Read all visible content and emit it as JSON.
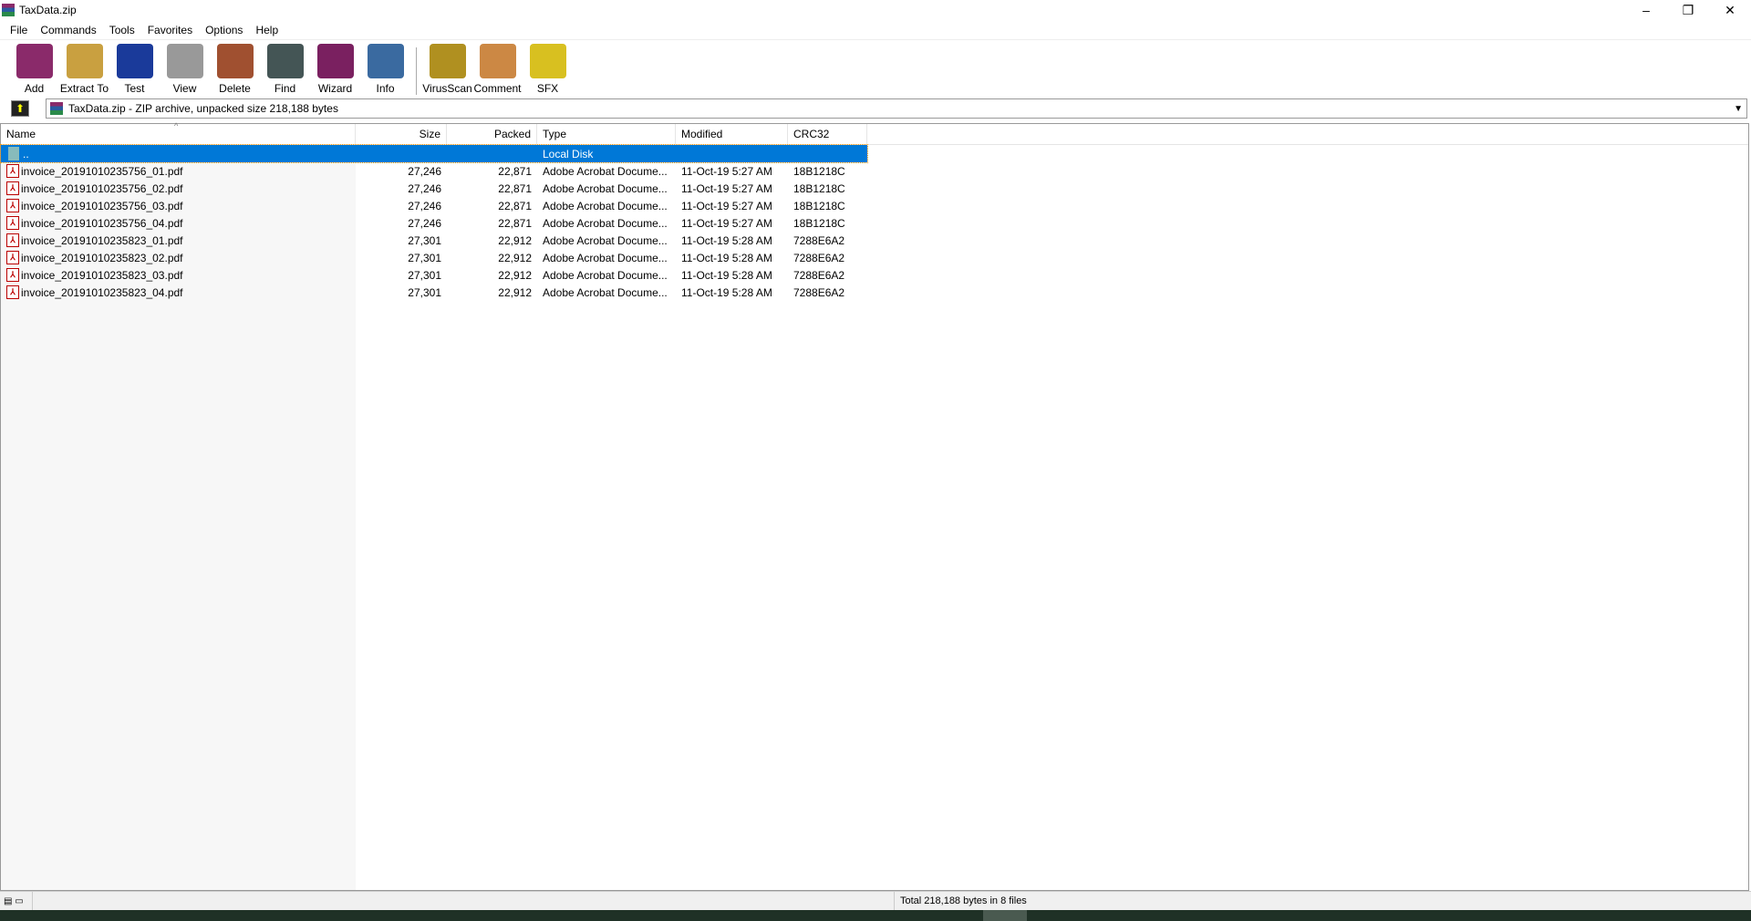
{
  "window": {
    "title": "TaxData.zip",
    "minimize": "–",
    "maximize": "❐",
    "close": "✕"
  },
  "menu": [
    "File",
    "Commands",
    "Tools",
    "Favorites",
    "Options",
    "Help"
  ],
  "toolbar": [
    {
      "label": "Add",
      "icon": "add-archive-icon",
      "color": "#8a2a6a"
    },
    {
      "label": "Extract To",
      "icon": "extract-icon",
      "color": "#c9a040"
    },
    {
      "label": "Test",
      "icon": "test-icon",
      "color": "#1a3a9a"
    },
    {
      "label": "View",
      "icon": "view-icon",
      "color": "#999999"
    },
    {
      "label": "Delete",
      "icon": "delete-icon",
      "color": "#a05030"
    },
    {
      "label": "Find",
      "icon": "find-icon",
      "color": "#445555"
    },
    {
      "label": "Wizard",
      "icon": "wizard-icon",
      "color": "#7a2060"
    },
    {
      "label": "Info",
      "icon": "info-icon",
      "color": "#3a6aa0"
    },
    {
      "label": "VirusScan",
      "icon": "virusscan-icon",
      "color": "#b09020"
    },
    {
      "label": "Comment",
      "icon": "comment-icon",
      "color": "#cc8844"
    },
    {
      "label": "SFX",
      "icon": "sfx-icon",
      "color": "#d8c020"
    }
  ],
  "address": {
    "text": "TaxData.zip - ZIP archive, unpacked size 218,188 bytes"
  },
  "columns": [
    "Name",
    "Size",
    "Packed",
    "Type",
    "Modified",
    "CRC32"
  ],
  "parent_row": {
    "name": "..",
    "type": "Local Disk"
  },
  "files": [
    {
      "name": "invoice_20191010235756_01.pdf",
      "size": "27,246",
      "packed": "22,871",
      "type": "Adobe Acrobat Docume...",
      "modified": "11-Oct-19 5:27 AM",
      "crc": "18B1218C"
    },
    {
      "name": "invoice_20191010235756_02.pdf",
      "size": "27,246",
      "packed": "22,871",
      "type": "Adobe Acrobat Docume...",
      "modified": "11-Oct-19 5:27 AM",
      "crc": "18B1218C"
    },
    {
      "name": "invoice_20191010235756_03.pdf",
      "size": "27,246",
      "packed": "22,871",
      "type": "Adobe Acrobat Docume...",
      "modified": "11-Oct-19 5:27 AM",
      "crc": "18B1218C"
    },
    {
      "name": "invoice_20191010235756_04.pdf",
      "size": "27,246",
      "packed": "22,871",
      "type": "Adobe Acrobat Docume...",
      "modified": "11-Oct-19 5:27 AM",
      "crc": "18B1218C"
    },
    {
      "name": "invoice_20191010235823_01.pdf",
      "size": "27,301",
      "packed": "22,912",
      "type": "Adobe Acrobat Docume...",
      "modified": "11-Oct-19 5:28 AM",
      "crc": "7288E6A2"
    },
    {
      "name": "invoice_20191010235823_02.pdf",
      "size": "27,301",
      "packed": "22,912",
      "type": "Adobe Acrobat Docume...",
      "modified": "11-Oct-19 5:28 AM",
      "crc": "7288E6A2"
    },
    {
      "name": "invoice_20191010235823_03.pdf",
      "size": "27,301",
      "packed": "22,912",
      "type": "Adobe Acrobat Docume...",
      "modified": "11-Oct-19 5:28 AM",
      "crc": "7288E6A2"
    },
    {
      "name": "invoice_20191010235823_04.pdf",
      "size": "27,301",
      "packed": "22,912",
      "type": "Adobe Acrobat Docume...",
      "modified": "11-Oct-19 5:28 AM",
      "crc": "7288E6A2"
    }
  ],
  "status": {
    "total": "Total 218,188 bytes in 8 files"
  }
}
